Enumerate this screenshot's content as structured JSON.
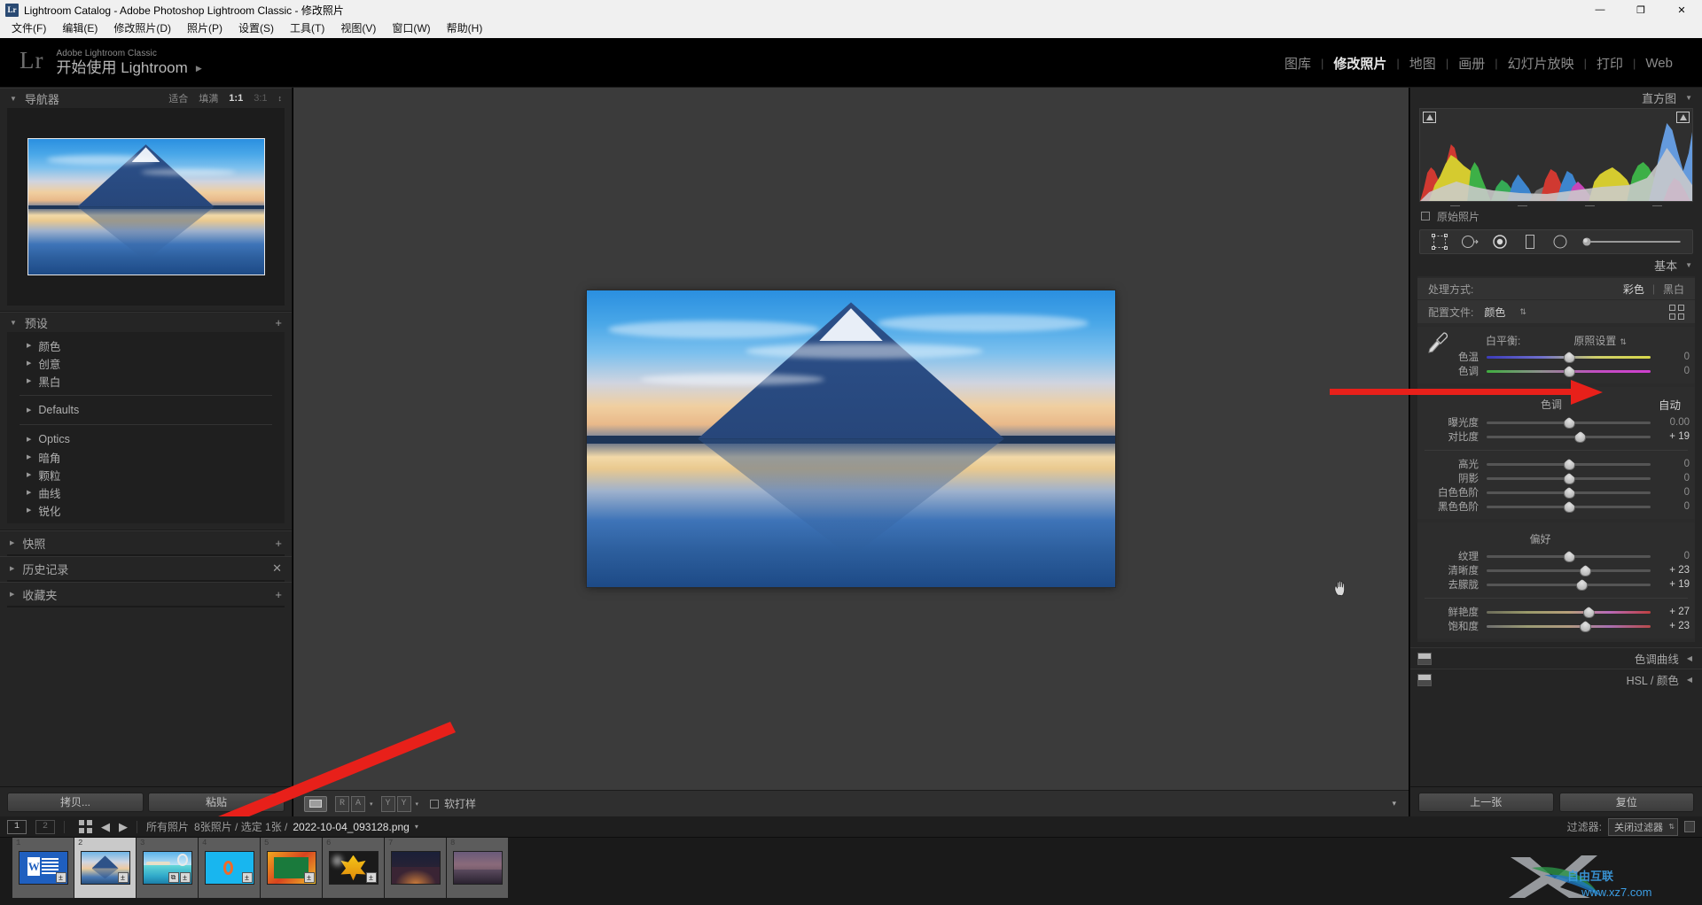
{
  "window": {
    "title": "Lightroom Catalog - Adobe Photoshop Lightroom Classic - 修改照片",
    "app_icon": "Lr",
    "minimize": "—",
    "maximize": "❐",
    "close": "✕"
  },
  "menubar": {
    "items": [
      "文件(F)",
      "编辑(E)",
      "修改照片(D)",
      "照片(P)",
      "设置(S)",
      "工具(T)",
      "视图(V)",
      "窗口(W)",
      "帮助(H)"
    ]
  },
  "identity": {
    "logo": "Lr",
    "line1": "Adobe Lightroom Classic",
    "line2": "开始使用 Lightroom",
    "arrow": "▶"
  },
  "modules": {
    "items": [
      {
        "label": "图库",
        "active": false
      },
      {
        "label": "修改照片",
        "active": true
      },
      {
        "label": "地图",
        "active": false
      },
      {
        "label": "画册",
        "active": false
      },
      {
        "label": "幻灯片放映",
        "active": false
      },
      {
        "label": "打印",
        "active": false
      },
      {
        "label": "Web",
        "active": false
      }
    ],
    "separator": "|"
  },
  "left_panel": {
    "navigator": {
      "title": "导航器",
      "triangle": "▼",
      "modes": [
        "适合",
        "填满",
        "1:1",
        "3:1"
      ],
      "selected_mode": "1:1",
      "updown": "↕"
    },
    "presets": {
      "title": "预设",
      "triangle": "▼",
      "add_icon": "+",
      "groups": [
        {
          "label": "颜色",
          "divider_after": false
        },
        {
          "label": "创意",
          "divider_after": false
        },
        {
          "label": "黑白",
          "divider_after": true
        },
        {
          "label": "Defaults",
          "divider_after": true
        },
        {
          "label": "Optics",
          "divider_after": false
        },
        {
          "label": "暗角",
          "divider_after": false
        },
        {
          "label": "颗粒",
          "divider_after": false
        },
        {
          "label": "曲线",
          "divider_after": false
        },
        {
          "label": "锐化",
          "divider_after": false
        }
      ],
      "row_triangle": "▶"
    },
    "sections": [
      {
        "label": "快照",
        "action": "+"
      },
      {
        "label": "历史记录",
        "action": "✕"
      },
      {
        "label": "收藏夹",
        "action": "+"
      }
    ],
    "buttons": {
      "copy": "拷贝...",
      "paste": "粘贴"
    }
  },
  "toolbar": {
    "view_icon": "loupe-view-icon",
    "ra_left": "R",
    "ra_right": "A",
    "yy_left": "Y",
    "yy_right": "Y",
    "caret": "▾",
    "soft_proof_label": "软打样",
    "right_caret": "▾"
  },
  "right_panel": {
    "histogram": {
      "title": "直方图",
      "triangle": "▼",
      "original_label": "原始照片"
    },
    "tools": [
      "crop-overlay-icon",
      "spot-removal-icon",
      "red-eye-icon",
      "linear-gradient-icon",
      "radial-gradient-icon",
      "adjustment-brush-icon"
    ],
    "basic": {
      "title": "基本",
      "triangle": "▼",
      "treatment_label": "处理方式:",
      "treatment_color": "彩色",
      "treatment_bw": "黑白",
      "treatment_sep": "|",
      "profile_label": "配置文件:",
      "profile_value": "颜色",
      "profile_updown": "⇅",
      "grid_icon": "profile-browser-icon",
      "white_balance": {
        "label": "白平衡:",
        "value": "原照设置",
        "updown": "⇅",
        "eyedropper": "white-balance-selector-icon",
        "sliders": [
          {
            "name": "色温",
            "value": "0",
            "pos": 50,
            "grad": "grad-temp",
            "zero": true
          },
          {
            "name": "色调",
            "value": "0",
            "pos": 50,
            "grad": "grad-tint",
            "zero": true
          }
        ]
      },
      "tone": {
        "label": "色调",
        "auto": "自动",
        "sliders": [
          {
            "name": "曝光度",
            "value": "0.00",
            "pos": 50,
            "zero": true
          },
          {
            "name": "对比度",
            "value": "+ 19",
            "pos": 57,
            "zero": false
          }
        ],
        "sliders2": [
          {
            "name": "高光",
            "value": "0",
            "pos": 50,
            "zero": true
          },
          {
            "name": "阴影",
            "value": "0",
            "pos": 50,
            "zero": true
          },
          {
            "name": "白色色阶",
            "value": "0",
            "pos": 50,
            "zero": true
          },
          {
            "name": "黑色色阶",
            "value": "0",
            "pos": 50,
            "zero": true
          }
        ]
      },
      "presence": {
        "label": "偏好",
        "sliders": [
          {
            "name": "纹理",
            "value": "0",
            "pos": 50,
            "zero": true
          },
          {
            "name": "清晰度",
            "value": "+ 23",
            "pos": 60,
            "zero": false
          },
          {
            "name": "去朦胧",
            "value": "+ 19",
            "pos": 58,
            "zero": false
          }
        ],
        "sliders2": [
          {
            "name": "鲜艳度",
            "value": "+ 27",
            "pos": 62,
            "grad": "grad-vib",
            "zero": false
          },
          {
            "name": "饱和度",
            "value": "+ 23",
            "pos": 60,
            "grad": "grad-sat",
            "zero": false
          }
        ]
      }
    },
    "collapsed": [
      {
        "label": "色调曲线",
        "triangle": "◀"
      },
      {
        "label": "HSL / 颜色",
        "triangle": "◀"
      }
    ],
    "buttons": {
      "previous": "上一张",
      "reset": "复位"
    }
  },
  "filmstrip": {
    "page1": "1",
    "page2": "2",
    "grid_icon": "grid-view-icon",
    "back_arrow": "◀",
    "forward_arrow": "▶",
    "source_label": "所有照片",
    "count_text": "8张照片 / 选定 1张 /",
    "filename": "2022-10-04_093128.png",
    "caret": "▾",
    "filter_label": "过滤器:",
    "filter_value": "关闭过滤器",
    "filter_updown": "⇅",
    "thumbs": [
      {
        "num": "1",
        "kind": "word-doc",
        "selected": false,
        "badge": "±",
        "badge2": ""
      },
      {
        "num": "2",
        "kind": "fuji-lake",
        "selected": true,
        "badge": "±",
        "badge2": ""
      },
      {
        "num": "3",
        "kind": "beach",
        "selected": false,
        "badge": "±",
        "badge2": "⧉"
      },
      {
        "num": "4",
        "kind": "cyan-ring",
        "selected": false,
        "badge": "±",
        "badge2": ""
      },
      {
        "num": "5",
        "kind": "green-frame",
        "selected": false,
        "badge": "±",
        "badge2": ""
      },
      {
        "num": "6",
        "kind": "yellow-leaf",
        "selected": false,
        "badge": "±",
        "badge2": ""
      },
      {
        "num": "7",
        "kind": "night-city",
        "selected": false,
        "badge": "",
        "badge2": ""
      },
      {
        "num": "8",
        "kind": "dusk-city",
        "selected": false,
        "badge": "",
        "badge2": ""
      }
    ]
  },
  "watermark": {
    "brand": "自由互联",
    "url": "www.xz7.com",
    "mark": "X"
  },
  "colors": {
    "accent_red": "#e8201a",
    "panel_bg": "#252525",
    "canvas_bg": "#3b3b3b",
    "text_primary": "#d6d6d6",
    "text_dim": "#8d8d8d"
  }
}
